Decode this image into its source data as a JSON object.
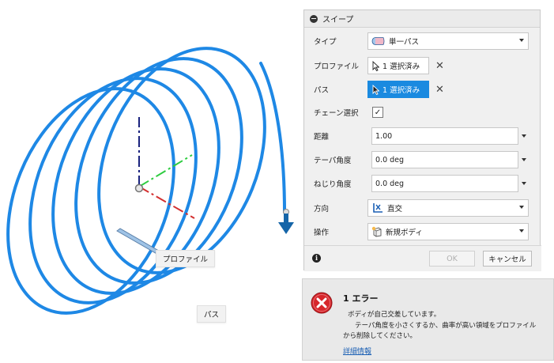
{
  "viewport": {
    "profile_label": "プロファイル",
    "path_label": "パス"
  },
  "dialog": {
    "title": "スイープ",
    "rows": {
      "type": {
        "label": "タイプ",
        "value": "単一パス"
      },
      "profile": {
        "label": "プロファイル",
        "value": "1 選択済み"
      },
      "path": {
        "label": "パス",
        "value": "1 選択済み"
      },
      "chain": {
        "label": "チェーン選択",
        "checked": true
      },
      "distance": {
        "label": "距離",
        "value": "1.00"
      },
      "taper": {
        "label": "テーパ角度",
        "value": "0.0 deg"
      },
      "twist": {
        "label": "ねじり角度",
        "value": "0.0 deg"
      },
      "orientation": {
        "label": "方向",
        "value": "直交"
      },
      "operation": {
        "label": "操作",
        "value": "新規ボディ"
      }
    },
    "ok_label": "OK",
    "cancel_label": "キャンセル"
  },
  "error": {
    "title": "1 エラー",
    "line1": "ボディが自己交差しています。",
    "line2": "テーパ角度を小さくするか、曲率が高い領域をプロファイル",
    "line3": "から削除してください。",
    "link": "詳細情報"
  },
  "colors": {
    "helix": "#1e88e5",
    "accent": "#1a8ae0",
    "axis_x": "#d32f2f",
    "axis_y": "#2ecc40",
    "axis_z": "#1a237e",
    "error_red": "#d7262b"
  }
}
